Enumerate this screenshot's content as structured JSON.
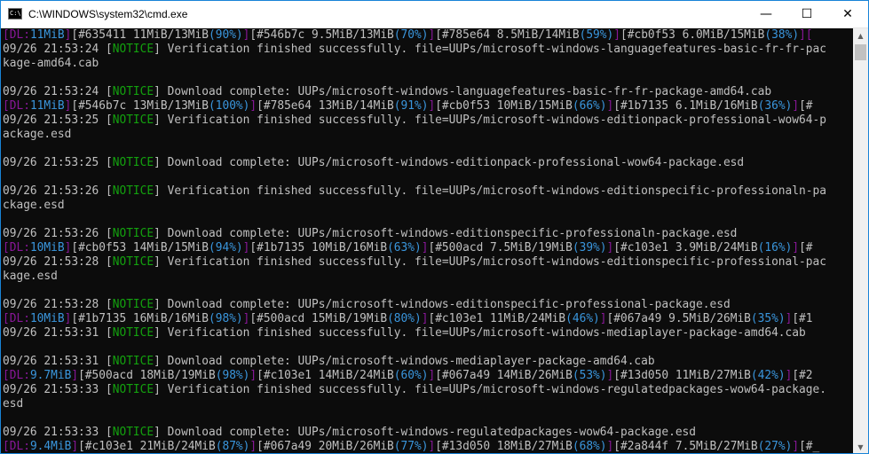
{
  "window": {
    "title": "C:\\WINDOWS\\system32\\cmd.exe",
    "icon_label": "C:\\",
    "minimize_glyph": "—",
    "maximize_glyph": "☐",
    "close_glyph": "✕"
  },
  "console": {
    "lines": [
      [
        [
          "m",
          "[DL:"
        ],
        [
          "b",
          "11MiB"
        ],
        [
          "m",
          "]"
        ],
        [
          "w",
          "[#635411 11MiB/13MiB"
        ],
        [
          "b",
          "(90%)"
        ],
        [
          "m",
          "]"
        ],
        [
          "w",
          "[#546b7c 9.5MiB/13MiB"
        ],
        [
          "b",
          "(70%)"
        ],
        [
          "m",
          "]"
        ],
        [
          "w",
          "[#785e64 8.5MiB/14MiB"
        ],
        [
          "b",
          "(59%)"
        ],
        [
          "m",
          "]"
        ],
        [
          "w",
          "[#cb0f53 6.0MiB/15MiB"
        ],
        [
          "b",
          "(38%)"
        ],
        [
          "m",
          "]["
        ]
      ],
      [
        [
          "w",
          "09/26 21:53:24 "
        ],
        [
          "w",
          "["
        ],
        [
          "g",
          "NOTICE"
        ],
        [
          "w",
          "] Verification finished successfully. file=UUPs/microsoft-windows-languagefeatures-basic-fr-fr-pac"
        ]
      ],
      [
        [
          "w",
          "kage-amd64.cab"
        ]
      ],
      [
        [
          "w",
          ""
        ]
      ],
      [
        [
          "w",
          "09/26 21:53:24 "
        ],
        [
          "w",
          "["
        ],
        [
          "g",
          "NOTICE"
        ],
        [
          "w",
          "] Download complete: UUPs/microsoft-windows-languagefeatures-basic-fr-fr-package-amd64.cab"
        ]
      ],
      [
        [
          "m",
          "[DL:"
        ],
        [
          "b",
          "11MiB"
        ],
        [
          "m",
          "]"
        ],
        [
          "w",
          "[#546b7c 13MiB/13MiB"
        ],
        [
          "b",
          "(100%)"
        ],
        [
          "m",
          "]"
        ],
        [
          "w",
          "[#785e64 13MiB/14MiB"
        ],
        [
          "b",
          "(91%)"
        ],
        [
          "m",
          "]"
        ],
        [
          "w",
          "[#cb0f53 10MiB/15MiB"
        ],
        [
          "b",
          "(66%)"
        ],
        [
          "m",
          "]"
        ],
        [
          "w",
          "[#1b7135 6.1MiB/16MiB"
        ],
        [
          "b",
          "(36%)"
        ],
        [
          "m",
          "]"
        ],
        [
          "w",
          "[#"
        ]
      ],
      [
        [
          "w",
          "09/26 21:53:25 "
        ],
        [
          "w",
          "["
        ],
        [
          "g",
          "NOTICE"
        ],
        [
          "w",
          "] Verification finished successfully. file=UUPs/microsoft-windows-editionpack-professional-wow64-p"
        ]
      ],
      [
        [
          "w",
          "ackage.esd"
        ]
      ],
      [
        [
          "w",
          ""
        ]
      ],
      [
        [
          "w",
          "09/26 21:53:25 "
        ],
        [
          "w",
          "["
        ],
        [
          "g",
          "NOTICE"
        ],
        [
          "w",
          "] Download complete: UUPs/microsoft-windows-editionpack-professional-wow64-package.esd"
        ]
      ],
      [
        [
          "w",
          ""
        ]
      ],
      [
        [
          "w",
          "09/26 21:53:26 "
        ],
        [
          "w",
          "["
        ],
        [
          "g",
          "NOTICE"
        ],
        [
          "w",
          "] Verification finished successfully. file=UUPs/microsoft-windows-editionspecific-professionaln-pa"
        ]
      ],
      [
        [
          "w",
          "ckage.esd"
        ]
      ],
      [
        [
          "w",
          ""
        ]
      ],
      [
        [
          "w",
          "09/26 21:53:26 "
        ],
        [
          "w",
          "["
        ],
        [
          "g",
          "NOTICE"
        ],
        [
          "w",
          "] Download complete: UUPs/microsoft-windows-editionspecific-professionaln-package.esd"
        ]
      ],
      [
        [
          "m",
          "[DL:"
        ],
        [
          "b",
          "10MiB"
        ],
        [
          "m",
          "]"
        ],
        [
          "w",
          "[#cb0f53 14MiB/15MiB"
        ],
        [
          "b",
          "(94%)"
        ],
        [
          "m",
          "]"
        ],
        [
          "w",
          "[#1b7135 10MiB/16MiB"
        ],
        [
          "b",
          "(63%)"
        ],
        [
          "m",
          "]"
        ],
        [
          "w",
          "[#500acd 7.5MiB/19MiB"
        ],
        [
          "b",
          "(39%)"
        ],
        [
          "m",
          "]"
        ],
        [
          "w",
          "[#c103e1 3.9MiB/24MiB"
        ],
        [
          "b",
          "(16%)"
        ],
        [
          "m",
          "]"
        ],
        [
          "w",
          "[#"
        ]
      ],
      [
        [
          "w",
          "09/26 21:53:28 "
        ],
        [
          "w",
          "["
        ],
        [
          "g",
          "NOTICE"
        ],
        [
          "w",
          "] Verification finished successfully. file=UUPs/microsoft-windows-editionspecific-professional-pac"
        ]
      ],
      [
        [
          "w",
          "kage.esd"
        ]
      ],
      [
        [
          "w",
          ""
        ]
      ],
      [
        [
          "w",
          "09/26 21:53:28 "
        ],
        [
          "w",
          "["
        ],
        [
          "g",
          "NOTICE"
        ],
        [
          "w",
          "] Download complete: UUPs/microsoft-windows-editionspecific-professional-package.esd"
        ]
      ],
      [
        [
          "m",
          "[DL:"
        ],
        [
          "b",
          "10MiB"
        ],
        [
          "m",
          "]"
        ],
        [
          "w",
          "[#1b7135 16MiB/16MiB"
        ],
        [
          "b",
          "(98%)"
        ],
        [
          "m",
          "]"
        ],
        [
          "w",
          "[#500acd 15MiB/19MiB"
        ],
        [
          "b",
          "(80%)"
        ],
        [
          "m",
          "]"
        ],
        [
          "w",
          "[#c103e1 11MiB/24MiB"
        ],
        [
          "b",
          "(46%)"
        ],
        [
          "m",
          "]"
        ],
        [
          "w",
          "[#067a49 9.5MiB/26MiB"
        ],
        [
          "b",
          "(35%)"
        ],
        [
          "m",
          "]"
        ],
        [
          "w",
          "[#1"
        ]
      ],
      [
        [
          "w",
          "09/26 21:53:31 "
        ],
        [
          "w",
          "["
        ],
        [
          "g",
          "NOTICE"
        ],
        [
          "w",
          "] Verification finished successfully. file=UUPs/microsoft-windows-mediaplayer-package-amd64.cab"
        ]
      ],
      [
        [
          "w",
          ""
        ]
      ],
      [
        [
          "w",
          "09/26 21:53:31 "
        ],
        [
          "w",
          "["
        ],
        [
          "g",
          "NOTICE"
        ],
        [
          "w",
          "] Download complete: UUPs/microsoft-windows-mediaplayer-package-amd64.cab"
        ]
      ],
      [
        [
          "m",
          "[DL:"
        ],
        [
          "b",
          "9.7MiB"
        ],
        [
          "m",
          "]"
        ],
        [
          "w",
          "[#500acd 18MiB/19MiB"
        ],
        [
          "b",
          "(98%)"
        ],
        [
          "m",
          "]"
        ],
        [
          "w",
          "[#c103e1 14MiB/24MiB"
        ],
        [
          "b",
          "(60%)"
        ],
        [
          "m",
          "]"
        ],
        [
          "w",
          "[#067a49 14MiB/26MiB"
        ],
        [
          "b",
          "(53%)"
        ],
        [
          "m",
          "]"
        ],
        [
          "w",
          "[#13d050 11MiB/27MiB"
        ],
        [
          "b",
          "(42%)"
        ],
        [
          "m",
          "]"
        ],
        [
          "w",
          "[#2"
        ]
      ],
      [
        [
          "w",
          "09/26 21:53:33 "
        ],
        [
          "w",
          "["
        ],
        [
          "g",
          "NOTICE"
        ],
        [
          "w",
          "] Verification finished successfully. file=UUPs/microsoft-windows-regulatedpackages-wow64-package."
        ]
      ],
      [
        [
          "w",
          "esd"
        ]
      ],
      [
        [
          "w",
          ""
        ]
      ],
      [
        [
          "w",
          "09/26 21:53:33 "
        ],
        [
          "w",
          "["
        ],
        [
          "g",
          "NOTICE"
        ],
        [
          "w",
          "] Download complete: UUPs/microsoft-windows-regulatedpackages-wow64-package.esd"
        ]
      ],
      [
        [
          "m",
          "[DL:"
        ],
        [
          "b",
          "9.4MiB"
        ],
        [
          "m",
          "]"
        ],
        [
          "w",
          "[#c103e1 21MiB/24MiB"
        ],
        [
          "b",
          "(87%)"
        ],
        [
          "m",
          "]"
        ],
        [
          "w",
          "[#067a49 20MiB/26MiB"
        ],
        [
          "b",
          "(77%)"
        ],
        [
          "m",
          "]"
        ],
        [
          "w",
          "[#13d050 18MiB/27MiB"
        ],
        [
          "b",
          "(68%)"
        ],
        [
          "m",
          "]"
        ],
        [
          "w",
          "[#2a844f 7.5MiB/27MiB"
        ],
        [
          "b",
          "(27%)"
        ],
        [
          "m",
          "]"
        ],
        [
          "w",
          "[#_"
        ]
      ]
    ]
  },
  "scrollbar": {
    "up_glyph": "▲",
    "down_glyph": "▼"
  }
}
